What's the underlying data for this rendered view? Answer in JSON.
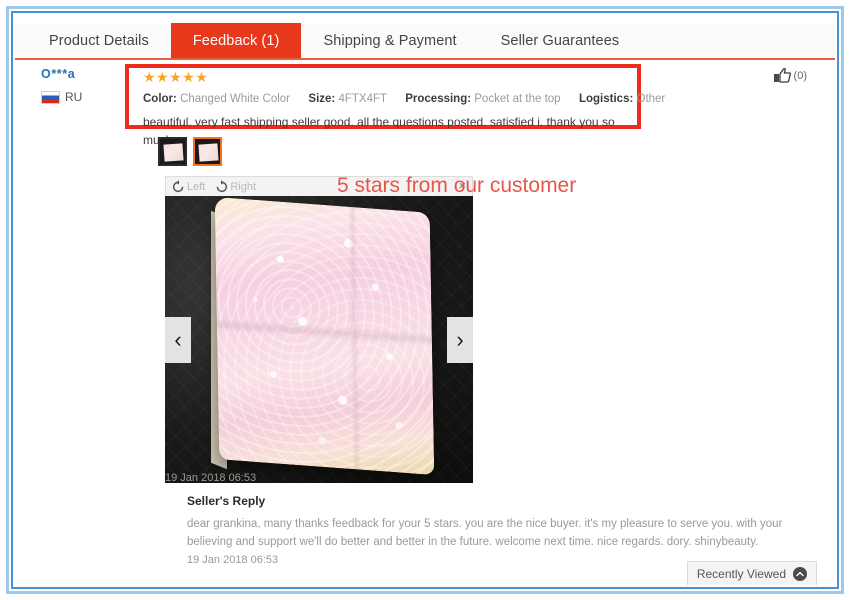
{
  "tabs": [
    {
      "label": "Product Details",
      "active": false
    },
    {
      "label": "Feedback (1)",
      "active": true
    },
    {
      "label": "Shipping & Payment",
      "active": false
    },
    {
      "label": "Seller Guarantees",
      "active": false
    }
  ],
  "review": {
    "reviewer_name": "O***a",
    "country_code": "RU",
    "rating_stars": "★★★★★",
    "rating_value": 5,
    "attributes": [
      {
        "label": "Color:",
        "value": "Changed White Color"
      },
      {
        "label": "Size:",
        "value": "4FTX4FT"
      },
      {
        "label": "Processing:",
        "value": "Pocket at the top"
      },
      {
        "label": "Logistics:",
        "value": "Other"
      }
    ],
    "text": "beautiful. very fast shipping seller good. all the questions posted. satisfied i. thank you so much.",
    "helpful_count": "(0)",
    "date": "19 Jan 2018 06:53"
  },
  "viewer": {
    "rotate_left_label": "Left",
    "rotate_right_label": "Right",
    "close_label": "×",
    "prev_label": "‹",
    "next_label": "›",
    "thumbnail_count": 2,
    "selected_thumbnail": 2
  },
  "annotation": {
    "text": "5 stars from our customer",
    "color": "#e8554a",
    "highlight_box_color": "#ee2b1e"
  },
  "seller_reply": {
    "title": "Seller's Reply",
    "body": "dear grankina, many thanks feedback for your 5 stars. you are the nice buyer. it's my pleasure to serve you. with your believing and support we'll do better and better in the future. welcome next time. nice regards. dory. shinybeauty.",
    "date": "19 Jan 2018 06:53"
  },
  "footer": {
    "recently_viewed_label": "Recently Viewed"
  },
  "colors": {
    "active_tab_bg": "#e8381c",
    "tab_underline": "#e8603c",
    "star": "#f5a623",
    "link_blue": "#2b6fb8",
    "frame_blue": "#4a90d9"
  }
}
